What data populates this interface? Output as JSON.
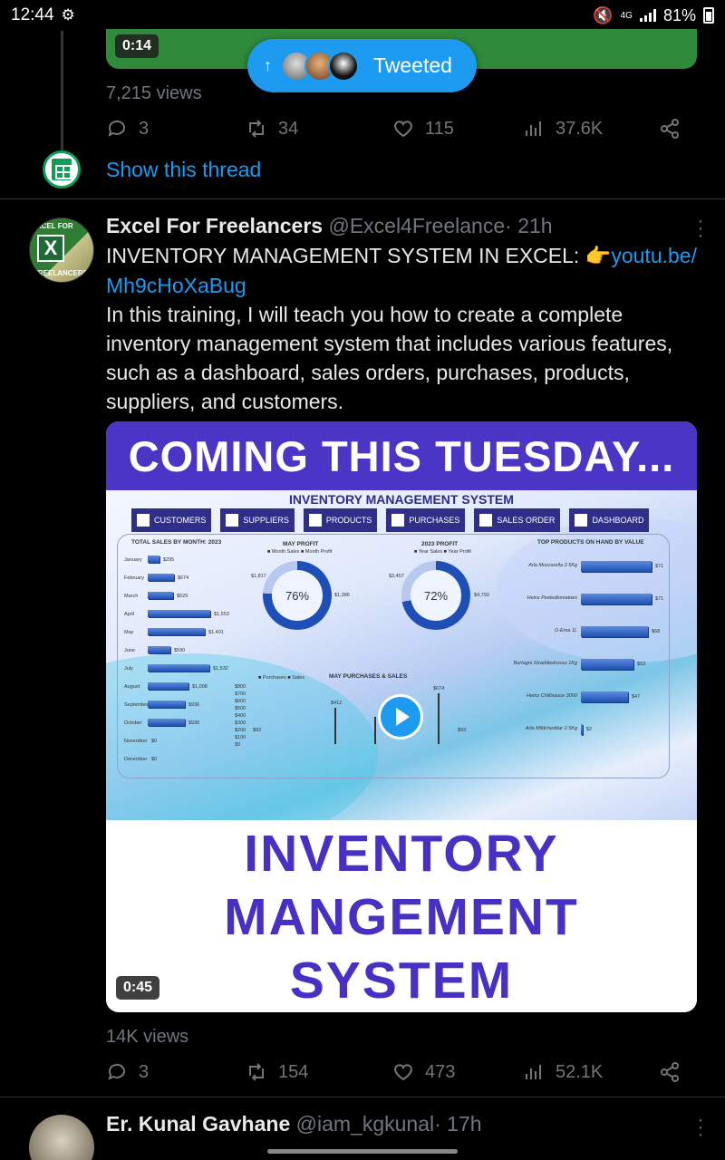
{
  "status_bar": {
    "time": "12:44",
    "network": "4G",
    "battery": "81%"
  },
  "prev_tweet": {
    "video_duration": "0:14",
    "views": "7,215 views",
    "replies": "3",
    "retweets": "34",
    "likes": "115",
    "analytics": "37.6K",
    "show_thread": "Show this thread"
  },
  "tweeted_pill": {
    "label": "Tweeted"
  },
  "tweet": {
    "author": "Excel For Freelancers",
    "handle": "@Excel4Freelance",
    "time": "· 21h",
    "text_prefix": "INVENTORY MANAGEMENT SYSTEM IN EXCEL: ",
    "emoji": "👉",
    "link_1": "youtu.be/",
    "link_2": "Mh9cHoXaBug",
    "body": "In this training, I will teach you how to create a complete inventory management system that includes various features, such as a dashboard, sales orders, purchases, products, suppliers, and customers.",
    "avatar_text_top": "EXCEL FOR",
    "avatar_text_bottom": "FREELANCERS",
    "avatar_letter": "X",
    "media": {
      "banner": "COMING THIS TUESDAY...",
      "dashboard_title": "INVENTORY MANAGEMENT SYSTEM",
      "nav": [
        "CUSTOMERS",
        "SUPPLIERS",
        "PRODUCTS",
        "PURCHASES",
        "SALES ORDER",
        "DASHBOARD"
      ],
      "total_sales_title": "TOTAL SALES BY MONTH: 2023",
      "months": [
        "January",
        "February",
        "March",
        "April",
        "May",
        "June",
        "July",
        "August",
        "September",
        "October",
        "November",
        "December"
      ],
      "month_values": [
        "$295",
        "$674",
        "$629",
        "$1,553",
        "$1,401",
        "$590",
        "$1,532",
        "$1,008",
        "$936",
        "$936",
        "$0",
        "$0"
      ],
      "month_fill": [
        0.1,
        0.23,
        0.22,
        0.55,
        0.5,
        0.2,
        0.54,
        0.36,
        0.33,
        0.33,
        0,
        0
      ],
      "may_profit_title": "MAY PROFIT",
      "may_profit_pct": "76%",
      "may_profit_legend": "■ Month Sales  ■ Month Profit",
      "may_profit_left": "$1,817",
      "may_profit_right": "$1,386",
      "year_profit_title": "2023 PROFIT",
      "year_profit_pct": "72%",
      "year_profit_legend": "■ Year Sales  ■ Year Profit",
      "year_profit_left": "$3,457",
      "year_profit_right": "$4,793",
      "top_products_title": "TOP PRODUCTS ON HAND BY VALUE",
      "top_products": [
        {
          "name": "Arla Mozzarella 2.5Kg",
          "value": "$71",
          "fill": 0.95
        },
        {
          "name": "Heinz Peeledtomatoes",
          "value": "$71",
          "fill": 0.95
        },
        {
          "name": "O-Ema 1L",
          "value": "$68",
          "fill": 0.9
        },
        {
          "name": "Bertagni Straddiedrosso 1Kg",
          "value": "$53",
          "fill": 0.71
        },
        {
          "name": "Heinz Chillisauce 3000",
          "value": "$47",
          "fill": 0.63
        },
        {
          "name": "Arla Mildcheddar 2.5Kg",
          "value": "$2",
          "fill": 0.03
        }
      ],
      "purchases_title": "MAY PURCHASES & SALES",
      "purchases_legend": "■ Purchases  ■ Sales",
      "purchases_y": [
        "$800",
        "$700",
        "$600",
        "$500",
        "$400",
        "$300",
        "$200",
        "$100",
        "$0"
      ],
      "purchases_peaks": [
        "$92",
        "$412",
        "$674",
        "$93"
      ],
      "bottom_line_1": "INVENTORY",
      "bottom_line_2": "MANGEMENT",
      "bottom_line_3": "SYSTEM",
      "video_duration": "0:45"
    },
    "views": "14K views",
    "replies": "3",
    "retweets": "154",
    "likes": "473",
    "analytics": "52.1K"
  },
  "next_tweet": {
    "author": "Er. Kunal Gavhane",
    "handle": "@iam_kgkunal",
    "time": "· 17h"
  },
  "colors": {
    "accent": "#1d9bf0",
    "muted": "#71767b",
    "banner": "#4b35c7"
  }
}
